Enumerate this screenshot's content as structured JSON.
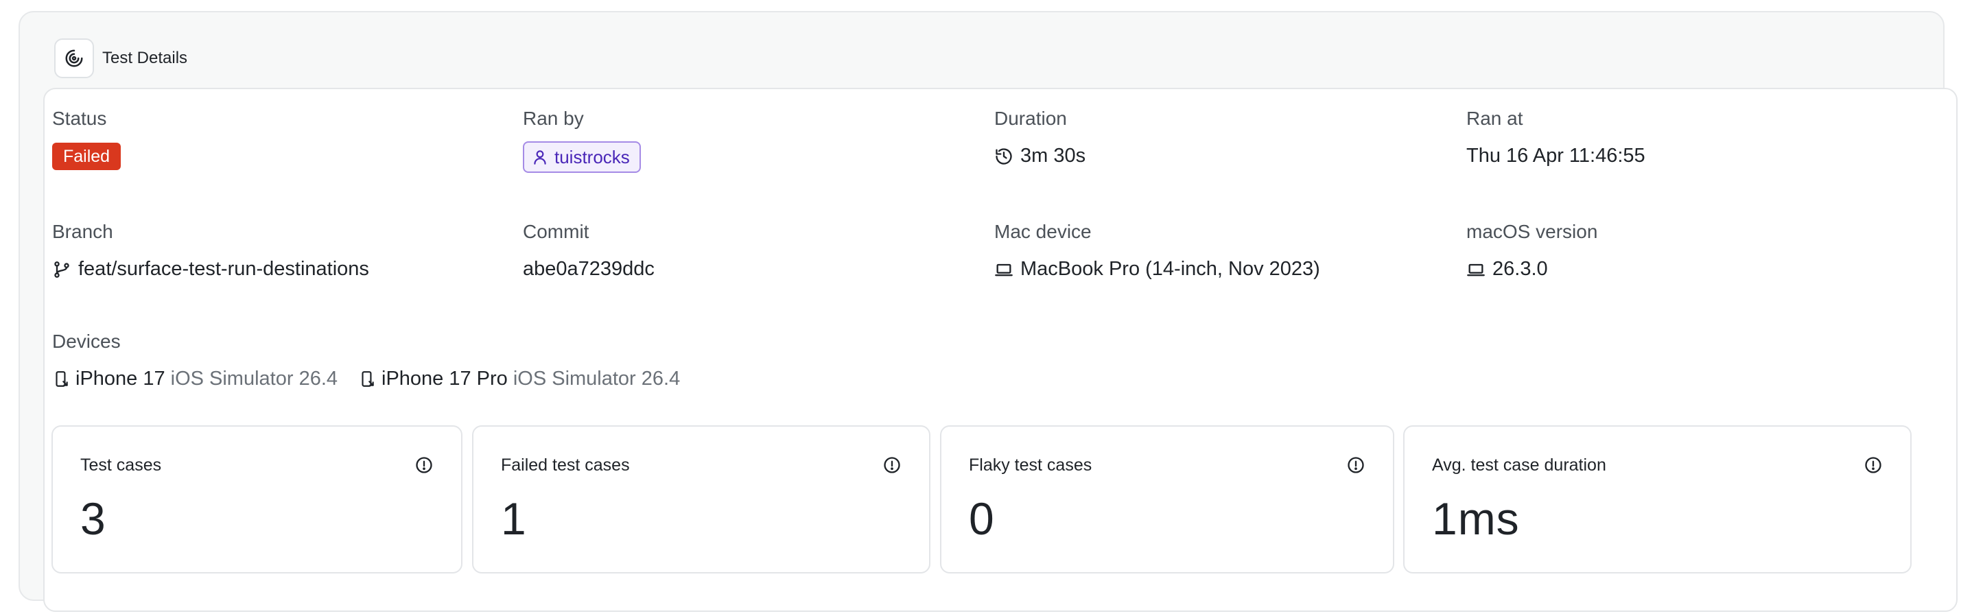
{
  "header": {
    "title": "Test Details",
    "icon": "tuist-logo-icon"
  },
  "fields": {
    "status": {
      "label": "Status",
      "value": "Failed",
      "color": "#d9381e"
    },
    "ran_by": {
      "label": "Ran by",
      "value": "tuistrocks",
      "icon": "user-icon"
    },
    "duration": {
      "label": "Duration",
      "value": "3m 30s",
      "icon": "history-icon"
    },
    "ran_at": {
      "label": "Ran at",
      "value": "Thu 16 Apr 11:46:55"
    },
    "branch": {
      "label": "Branch",
      "value": "feat/surface-test-run-destinations",
      "icon": "git-branch-icon"
    },
    "commit": {
      "label": "Commit",
      "value": "abe0a7239ddc"
    },
    "mac_device": {
      "label": "Mac device",
      "value": "MacBook Pro (14-inch, Nov 2023)",
      "icon": "laptop-icon"
    },
    "macos_version": {
      "label": "macOS version",
      "value": "26.3.0",
      "icon": "laptop-icon"
    }
  },
  "devices": {
    "label": "Devices",
    "items": [
      {
        "name": "iPhone 17",
        "runtime": "iOS Simulator 26.4",
        "icon": "device-mobile-icon"
      },
      {
        "name": "iPhone 17 Pro",
        "runtime": "iOS Simulator 26.4",
        "icon": "device-mobile-icon"
      }
    ]
  },
  "metrics": [
    {
      "label": "Test cases",
      "value": "3",
      "icon": "info-circle-icon"
    },
    {
      "label": "Failed test cases",
      "value": "1",
      "icon": "info-circle-icon"
    },
    {
      "label": "Flaky test cases",
      "value": "0",
      "icon": "info-circle-icon"
    },
    {
      "label": "Avg. test case duration",
      "value": "1ms",
      "icon": "info-circle-icon"
    }
  ]
}
